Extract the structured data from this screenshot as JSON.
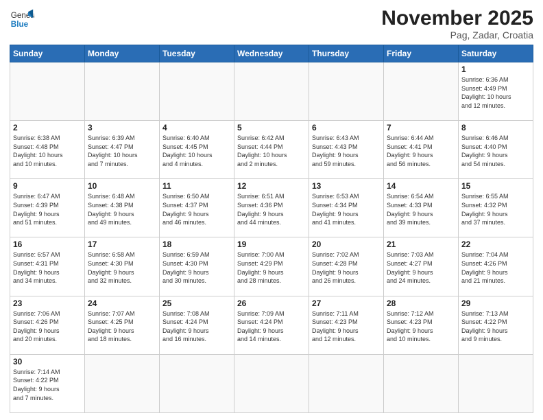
{
  "header": {
    "logo_general": "General",
    "logo_blue": "Blue",
    "month_title": "November 2025",
    "subtitle": "Pag, Zadar, Croatia"
  },
  "weekdays": [
    "Sunday",
    "Monday",
    "Tuesday",
    "Wednesday",
    "Thursday",
    "Friday",
    "Saturday"
  ],
  "weeks": [
    [
      {
        "day": "",
        "info": ""
      },
      {
        "day": "",
        "info": ""
      },
      {
        "day": "",
        "info": ""
      },
      {
        "day": "",
        "info": ""
      },
      {
        "day": "",
        "info": ""
      },
      {
        "day": "",
        "info": ""
      },
      {
        "day": "1",
        "info": "Sunrise: 6:36 AM\nSunset: 4:49 PM\nDaylight: 10 hours\nand 12 minutes."
      }
    ],
    [
      {
        "day": "2",
        "info": "Sunrise: 6:38 AM\nSunset: 4:48 PM\nDaylight: 10 hours\nand 10 minutes."
      },
      {
        "day": "3",
        "info": "Sunrise: 6:39 AM\nSunset: 4:47 PM\nDaylight: 10 hours\nand 7 minutes."
      },
      {
        "day": "4",
        "info": "Sunrise: 6:40 AM\nSunset: 4:45 PM\nDaylight: 10 hours\nand 4 minutes."
      },
      {
        "day": "5",
        "info": "Sunrise: 6:42 AM\nSunset: 4:44 PM\nDaylight: 10 hours\nand 2 minutes."
      },
      {
        "day": "6",
        "info": "Sunrise: 6:43 AM\nSunset: 4:43 PM\nDaylight: 9 hours\nand 59 minutes."
      },
      {
        "day": "7",
        "info": "Sunrise: 6:44 AM\nSunset: 4:41 PM\nDaylight: 9 hours\nand 56 minutes."
      },
      {
        "day": "8",
        "info": "Sunrise: 6:46 AM\nSunset: 4:40 PM\nDaylight: 9 hours\nand 54 minutes."
      }
    ],
    [
      {
        "day": "9",
        "info": "Sunrise: 6:47 AM\nSunset: 4:39 PM\nDaylight: 9 hours\nand 51 minutes."
      },
      {
        "day": "10",
        "info": "Sunrise: 6:48 AM\nSunset: 4:38 PM\nDaylight: 9 hours\nand 49 minutes."
      },
      {
        "day": "11",
        "info": "Sunrise: 6:50 AM\nSunset: 4:37 PM\nDaylight: 9 hours\nand 46 minutes."
      },
      {
        "day": "12",
        "info": "Sunrise: 6:51 AM\nSunset: 4:36 PM\nDaylight: 9 hours\nand 44 minutes."
      },
      {
        "day": "13",
        "info": "Sunrise: 6:53 AM\nSunset: 4:34 PM\nDaylight: 9 hours\nand 41 minutes."
      },
      {
        "day": "14",
        "info": "Sunrise: 6:54 AM\nSunset: 4:33 PM\nDaylight: 9 hours\nand 39 minutes."
      },
      {
        "day": "15",
        "info": "Sunrise: 6:55 AM\nSunset: 4:32 PM\nDaylight: 9 hours\nand 37 minutes."
      }
    ],
    [
      {
        "day": "16",
        "info": "Sunrise: 6:57 AM\nSunset: 4:31 PM\nDaylight: 9 hours\nand 34 minutes."
      },
      {
        "day": "17",
        "info": "Sunrise: 6:58 AM\nSunset: 4:30 PM\nDaylight: 9 hours\nand 32 minutes."
      },
      {
        "day": "18",
        "info": "Sunrise: 6:59 AM\nSunset: 4:30 PM\nDaylight: 9 hours\nand 30 minutes."
      },
      {
        "day": "19",
        "info": "Sunrise: 7:00 AM\nSunset: 4:29 PM\nDaylight: 9 hours\nand 28 minutes."
      },
      {
        "day": "20",
        "info": "Sunrise: 7:02 AM\nSunset: 4:28 PM\nDaylight: 9 hours\nand 26 minutes."
      },
      {
        "day": "21",
        "info": "Sunrise: 7:03 AM\nSunset: 4:27 PM\nDaylight: 9 hours\nand 24 minutes."
      },
      {
        "day": "22",
        "info": "Sunrise: 7:04 AM\nSunset: 4:26 PM\nDaylight: 9 hours\nand 21 minutes."
      }
    ],
    [
      {
        "day": "23",
        "info": "Sunrise: 7:06 AM\nSunset: 4:26 PM\nDaylight: 9 hours\nand 20 minutes."
      },
      {
        "day": "24",
        "info": "Sunrise: 7:07 AM\nSunset: 4:25 PM\nDaylight: 9 hours\nand 18 minutes."
      },
      {
        "day": "25",
        "info": "Sunrise: 7:08 AM\nSunset: 4:24 PM\nDaylight: 9 hours\nand 16 minutes."
      },
      {
        "day": "26",
        "info": "Sunrise: 7:09 AM\nSunset: 4:24 PM\nDaylight: 9 hours\nand 14 minutes."
      },
      {
        "day": "27",
        "info": "Sunrise: 7:11 AM\nSunset: 4:23 PM\nDaylight: 9 hours\nand 12 minutes."
      },
      {
        "day": "28",
        "info": "Sunrise: 7:12 AM\nSunset: 4:23 PM\nDaylight: 9 hours\nand 10 minutes."
      },
      {
        "day": "29",
        "info": "Sunrise: 7:13 AM\nSunset: 4:22 PM\nDaylight: 9 hours\nand 9 minutes."
      }
    ],
    [
      {
        "day": "30",
        "info": "Sunrise: 7:14 AM\nSunset: 4:22 PM\nDaylight: 9 hours\nand 7 minutes."
      },
      {
        "day": "",
        "info": ""
      },
      {
        "day": "",
        "info": ""
      },
      {
        "day": "",
        "info": ""
      },
      {
        "day": "",
        "info": ""
      },
      {
        "day": "",
        "info": ""
      },
      {
        "day": "",
        "info": ""
      }
    ]
  ]
}
